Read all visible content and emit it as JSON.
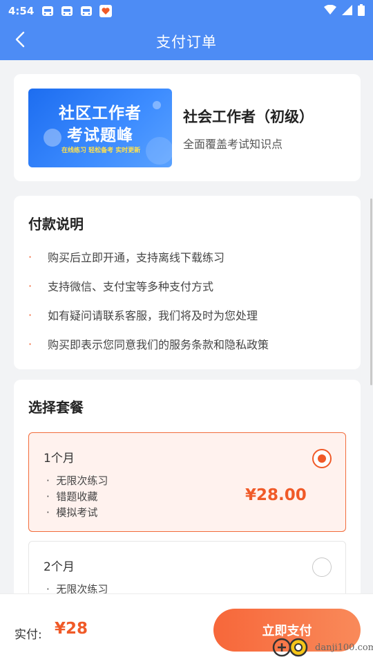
{
  "status_bar": {
    "time": "4:54",
    "app_icons": [
      "car-icon",
      "car-icon",
      "car-icon",
      "heart-app-icon"
    ],
    "right_icons": [
      "wifi-icon",
      "signal-icon",
      "battery-icon"
    ]
  },
  "header": {
    "title": "支付订单",
    "back_icon": "chevron-left-icon",
    "background": "#4d8cf5"
  },
  "product": {
    "banner_title_line1": "社区工作者",
    "banner_title_line2": "考试题峰",
    "banner_subtitle": "在线练习 轻松备考 实时更新",
    "name": "社会工作者（初级）",
    "description": "全面覆盖考试知识点"
  },
  "payment_notes": {
    "title": "付款说明",
    "items": [
      "购买后立即开通，支持离线下载练习",
      "支持微信、支付宝等多种支付方式",
      "如有疑问请联系客服，我们将及时为您处理",
      "购买即表示您同意我们的服务条款和隐私政策"
    ]
  },
  "plans": {
    "title": "选择套餐",
    "options": [
      {
        "name": "1个月",
        "features": [
          "无限次练习",
          "错题收藏",
          "模拟考试"
        ],
        "price": "¥28.00",
        "selected": true
      },
      {
        "name": "2个月",
        "features": [
          "无限次练习"
        ],
        "selected": false
      }
    ]
  },
  "footer": {
    "paid_label": "实付:",
    "paid_amount": "¥28",
    "pay_button": "立即支付"
  },
  "watermark": {
    "text": "danji100.com"
  },
  "colors": {
    "primary": "#4d8cf5",
    "accent": "#f05a28",
    "selected_bg": "#fff2ee"
  }
}
